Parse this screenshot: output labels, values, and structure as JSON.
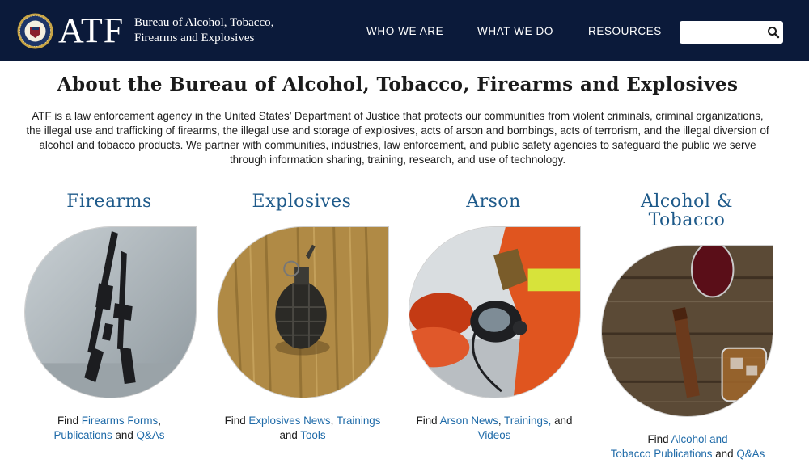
{
  "header": {
    "logo_text": "ATF",
    "agency_line1": "Bureau of Alcohol, Tobacco,",
    "agency_line2": "Firearms and Explosives",
    "nav": [
      "WHO WE ARE",
      "WHAT WE DO",
      "RESOURCES"
    ],
    "search_value": "",
    "search_icon": "search-icon",
    "seal_icon": "atf-seal-icon",
    "colors": {
      "header_bg": "#0b1a3a",
      "link": "#1e6aa8",
      "heading_link": "#1e5a8a"
    }
  },
  "main": {
    "title": "About the Bureau of Alcohol, Tobacco, Firearms and Explosives",
    "intro": "ATF is a law enforcement agency in the United States’ Department of Justice that protects our communities from violent criminals, criminal organizations, the illegal use and trafficking of firearms, the illegal use and storage of explosives, acts of arson and bombings, acts of terrorism, and the illegal diversion of alcohol and tobacco products. We partner with communities, industries, law enforcement, and public safety agencies to safeguard the public we serve through information sharing, training, research, and use of technology."
  },
  "topics": [
    {
      "title": "Firearms",
      "image": "rifles-against-wall-image",
      "caption": {
        "find": "Find",
        "link1": "Firearms Forms",
        "sep1": ",",
        "link2": "Publications",
        "and": "and",
        "link3": "Q&As"
      }
    },
    {
      "title": "Explosives",
      "image": "hand-grenade-on-wood-image",
      "caption": {
        "find": "Find",
        "link1": "Explosives News",
        "sep1": ",",
        "link2": "Trainings",
        "and": "and",
        "link3": "Tools"
      }
    },
    {
      "title": "Arson",
      "image": "firefighter-with-mask-image",
      "caption": {
        "find": "Find",
        "link1": "Arson News",
        "sep1": ",",
        "link2": "Trainings,",
        "and": "and",
        "link3": "Videos"
      }
    },
    {
      "title_line1": "Alcohol &",
      "title_line2": "Tobacco",
      "image": "wine-cigar-whiskey-image",
      "caption": {
        "find": "Find",
        "link1": "Alcohol and",
        "link1b": "Tobacco Publications",
        "and": "and",
        "link3": "Q&As"
      }
    }
  ]
}
